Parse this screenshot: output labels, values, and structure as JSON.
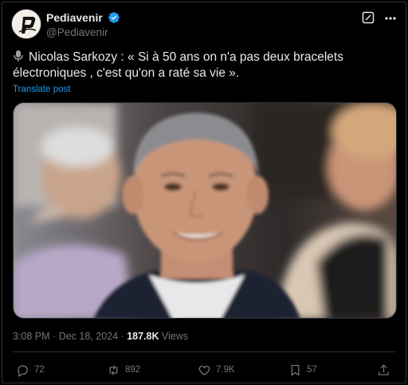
{
  "author": {
    "display_name": "Pediavenir",
    "handle": "@Pediavenir",
    "verified": true
  },
  "post": {
    "text": "Nicolas Sarkozy : « Si à 50 ans on n'a pas deux bracelets électroniques , c'est qu'on a raté sa vie ».",
    "leading_icon": "microphone-icon",
    "translate_label": "Translate post"
  },
  "meta": {
    "time": "3:08 PM",
    "separator": "·",
    "date": "Dec 18, 2024",
    "views_count": "187.8K",
    "views_label": "Views"
  },
  "actions": {
    "replies": "72",
    "reposts": "892",
    "likes": "7.9K",
    "bookmarks": "57"
  },
  "colors": {
    "background": "#000000",
    "text": "#e7e9ea",
    "secondary": "#71767b",
    "accent": "#1d9bf0",
    "border": "#2f3336"
  }
}
